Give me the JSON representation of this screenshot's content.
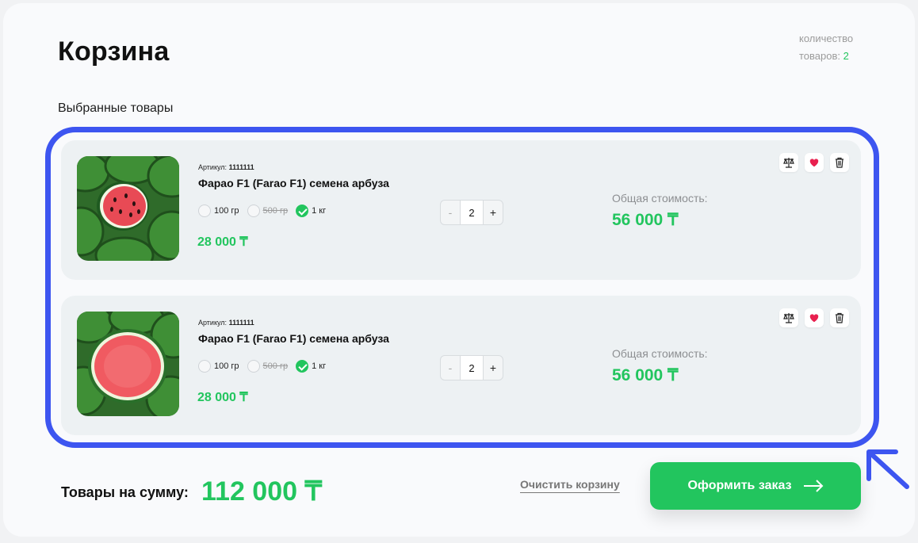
{
  "header": {
    "title": "Корзина",
    "count_label_line1": "количество",
    "count_label_line2": "товаров:",
    "count_value": "2",
    "subtitle": "Выбранные товары"
  },
  "items": [
    {
      "sku_label": "Артикул:",
      "sku_value": "1111111",
      "name": "Фарао F1 (Farao F1) семена арбуза",
      "weights": [
        {
          "label": "100 гр",
          "selected": false,
          "strikethrough": false
        },
        {
          "label": "500 гр",
          "selected": false,
          "strikethrough": true
        },
        {
          "label": "1 кг",
          "selected": true,
          "strikethrough": false
        }
      ],
      "price": "28 000 ₸",
      "quantity": "2",
      "minus": "-",
      "plus": "+",
      "total_label": "Общая стоимость:",
      "total_value": "56 000 ₸",
      "image_icon": "watermelon-image"
    },
    {
      "sku_label": "Артикул:",
      "sku_value": "1111111",
      "name": "Фарао F1 (Farao F1) семена арбуза",
      "weights": [
        {
          "label": "100 гр",
          "selected": false,
          "strikethrough": false
        },
        {
          "label": "500 гр",
          "selected": false,
          "strikethrough": true
        },
        {
          "label": "1 кг",
          "selected": true,
          "strikethrough": false
        }
      ],
      "price": "28 000 ₸",
      "quantity": "2",
      "minus": "-",
      "plus": "+",
      "total_label": "Общая стоимость:",
      "total_value": "56 000 ₸",
      "image_icon": "watermelon-image"
    }
  ],
  "footer": {
    "sum_label": "Товары на сумму:",
    "sum_value": "112 000 ₸",
    "clear_label": "Очистить корзину",
    "order_label": "Оформить заказ"
  },
  "colors": {
    "accent": "#22c55e",
    "highlight": "#3d55f0",
    "card": "#edf1f3"
  },
  "icons": [
    "scales-icon",
    "heart-icon",
    "trash-icon",
    "arrow-right-icon",
    "check-icon"
  ]
}
